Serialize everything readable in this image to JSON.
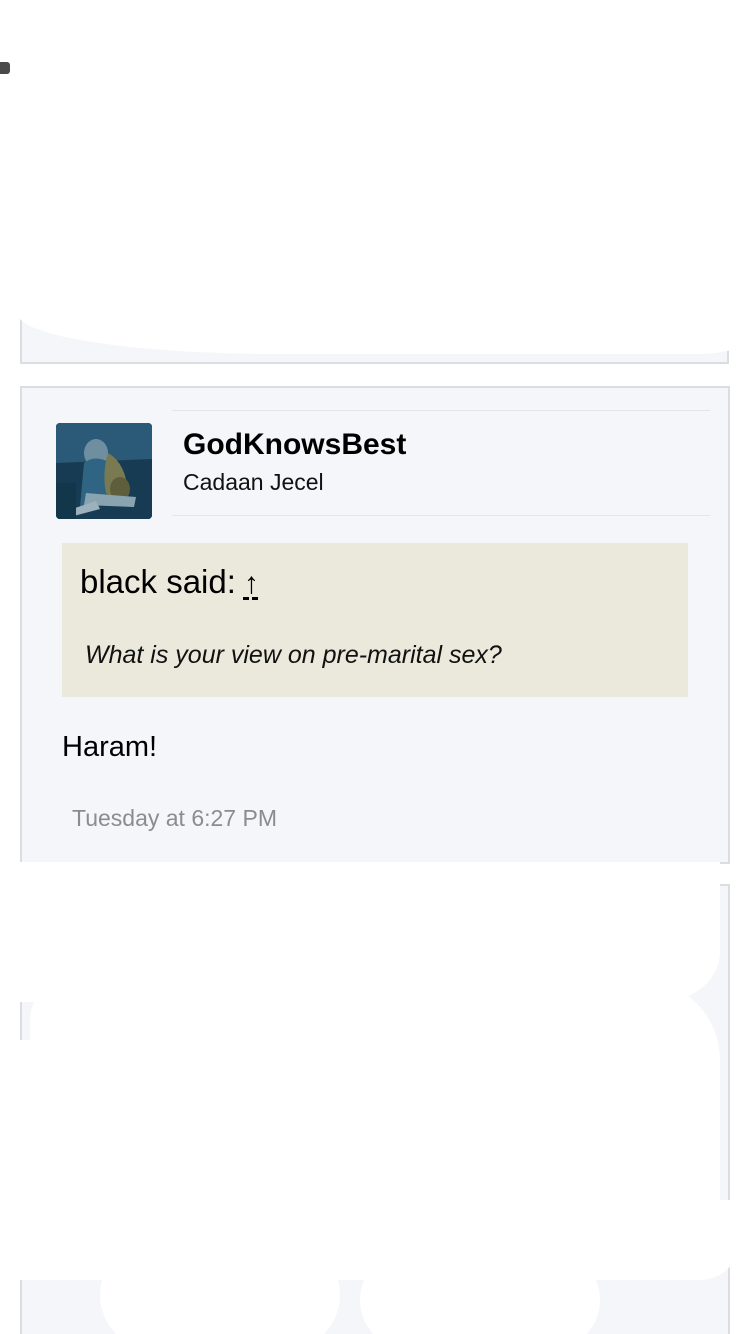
{
  "post": {
    "username": "GodKnowsBest",
    "user_title": "Cadaan Jecel",
    "avatar_icon": "old-guitarist-avatar",
    "quote": {
      "attribution": "black said:",
      "jump_icon": "↑",
      "text": "What is your view on pre-marital sex?"
    },
    "message": "Haram!",
    "date": "Tuesday at 6:27 PM"
  },
  "colors": {
    "post_background": "#f5f6fa",
    "post_border": "#dcdde2",
    "quote_background": "#ebe9dc",
    "date_text": "#8c8c8c"
  }
}
